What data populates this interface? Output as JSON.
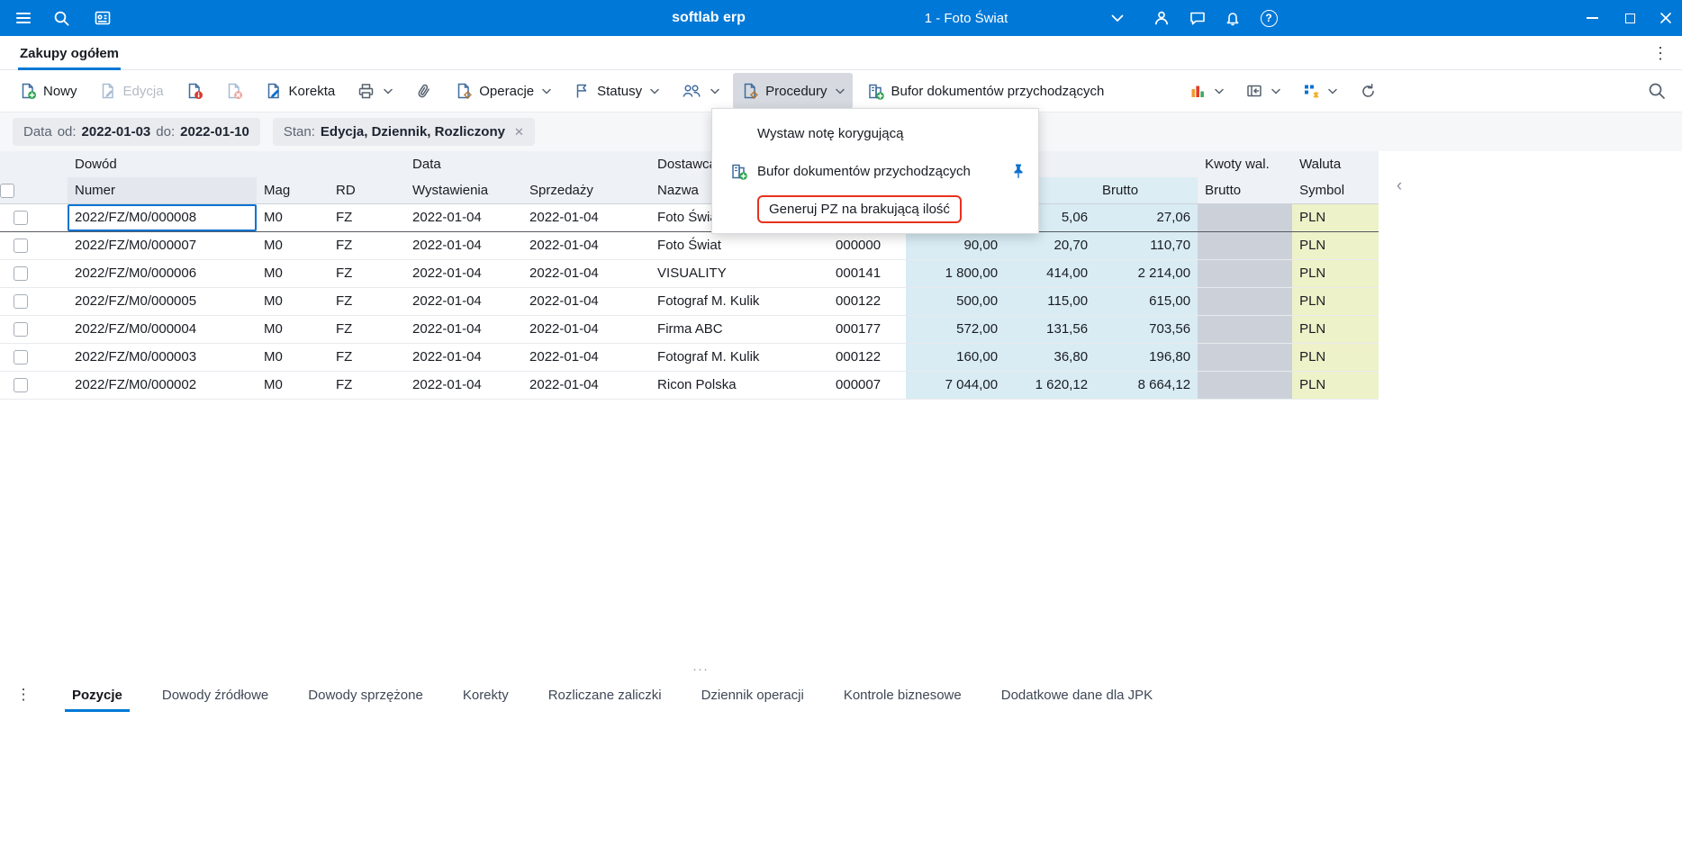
{
  "titlebar": {
    "title": "softlab erp",
    "company": "1 - Foto Świat"
  },
  "tabbar": {
    "active_tab": "Zakupy ogółem"
  },
  "toolbar": {
    "nowy": "Nowy",
    "edycja": "Edycja",
    "korekta": "Korekta",
    "operacje": "Operacje",
    "statusy": "Statusy",
    "procedury": "Procedury",
    "bufor": "Bufor dokumentów przychodzących"
  },
  "filterbar": {
    "data_label": "Data",
    "od_label": "od:",
    "od_value": "2022-01-03",
    "do_label": "do:",
    "do_value": "2022-01-10",
    "stan_label": "Stan:",
    "stan_value": "Edycja, Dziennik, Rozliczony"
  },
  "menu": {
    "item1": "Wystaw notę korygującą",
    "item2": "Bufor dokumentów przychodzących",
    "item3": "Generuj PZ na brakującą ilość"
  },
  "table": {
    "group_headers": {
      "dowod": "Dowód",
      "data": "Data",
      "dostawca": "Dostawca",
      "kwoty_wal": "Kwoty wal.",
      "waluta": "Waluta"
    },
    "column_headers": {
      "numer": "Numer",
      "mag": "Mag",
      "rd": "RD",
      "wystawienia": "Wystawienia",
      "sprzedazy": "Sprzedaży",
      "nazwa": "Nazwa",
      "brutto": "Brutto",
      "kwoty_brutto": "Brutto",
      "symbol": "Symbol"
    },
    "rows": [
      {
        "selected": true,
        "numer": "2022/FZ/M0/000008",
        "mag": "M0",
        "rd": "FZ",
        "wystawienia": "2022-01-04",
        "sprzedazy": "2022-01-04",
        "nazwa": "Foto Świat",
        "dostawca_numer": "",
        "netto": "",
        "vat": "5,06",
        "brutto": "27,06",
        "kwoty_brutto": "",
        "symbol": "PLN"
      },
      {
        "selected": false,
        "numer": "2022/FZ/M0/000007",
        "mag": "M0",
        "rd": "FZ",
        "wystawienia": "2022-01-04",
        "sprzedazy": "2022-01-04",
        "nazwa": "Foto Świat",
        "dostawca_numer": "000000",
        "netto": "90,00",
        "vat": "20,70",
        "brutto": "110,70",
        "kwoty_brutto": "",
        "symbol": "PLN"
      },
      {
        "selected": false,
        "numer": "2022/FZ/M0/000006",
        "mag": "M0",
        "rd": "FZ",
        "wystawienia": "2022-01-04",
        "sprzedazy": "2022-01-04",
        "nazwa": "VISUALITY",
        "dostawca_numer": "000141",
        "netto": "1 800,00",
        "vat": "414,00",
        "brutto": "2 214,00",
        "kwoty_brutto": "",
        "symbol": "PLN"
      },
      {
        "selected": false,
        "numer": "2022/FZ/M0/000005",
        "mag": "M0",
        "rd": "FZ",
        "wystawienia": "2022-01-04",
        "sprzedazy": "2022-01-04",
        "nazwa": "Fotograf M. Kulik",
        "dostawca_numer": "000122",
        "netto": "500,00",
        "vat": "115,00",
        "brutto": "615,00",
        "kwoty_brutto": "",
        "symbol": "PLN"
      },
      {
        "selected": false,
        "numer": "2022/FZ/M0/000004",
        "mag": "M0",
        "rd": "FZ",
        "wystawienia": "2022-01-04",
        "sprzedazy": "2022-01-04",
        "nazwa": "Firma ABC",
        "dostawca_numer": "000177",
        "netto": "572,00",
        "vat": "131,56",
        "brutto": "703,56",
        "kwoty_brutto": "",
        "symbol": "PLN"
      },
      {
        "selected": false,
        "numer": "2022/FZ/M0/000003",
        "mag": "M0",
        "rd": "FZ",
        "wystawienia": "2022-01-04",
        "sprzedazy": "2022-01-04",
        "nazwa": "Fotograf M. Kulik",
        "dostawca_numer": "000122",
        "netto": "160,00",
        "vat": "36,80",
        "brutto": "196,80",
        "kwoty_brutto": "",
        "symbol": "PLN"
      },
      {
        "selected": false,
        "numer": "2022/FZ/M0/000002",
        "mag": "M0",
        "rd": "FZ",
        "wystawienia": "2022-01-04",
        "sprzedazy": "2022-01-04",
        "nazwa": "Ricon Polska",
        "dostawca_numer": "000007",
        "netto": "7 044,00",
        "vat": "1 620,12",
        "brutto": "8 664,12",
        "kwoty_brutto": "",
        "symbol": "PLN"
      }
    ]
  },
  "bottom_tabs": {
    "items": [
      {
        "label": "Pozycje",
        "active": true
      },
      {
        "label": "Dowody źródłowe",
        "active": false
      },
      {
        "label": "Dowody sprzężone",
        "active": false
      },
      {
        "label": "Korekty",
        "active": false
      },
      {
        "label": "Rozliczane zaliczki",
        "active": false
      },
      {
        "label": "Dziennik operacji",
        "active": false
      },
      {
        "label": "Kontrole biznesowe",
        "active": false
      },
      {
        "label": "Dodatkowe dane dla JPK",
        "active": false
      }
    ]
  },
  "colors": {
    "titlebar_bg": "#0078d7",
    "accent_blue": "#0078d4",
    "numeric_cell_bg": "#d9ecf4",
    "currency_cell_bg": "#eef2c8",
    "amount_wal_cell_bg": "#ccd1d9",
    "highlight_red": "#e8321e",
    "focus_cell_border": "#0b72d0"
  },
  "icons": [
    "menu-icon",
    "search-icon",
    "contacts-icon",
    "chevron-down-icon",
    "user-icon",
    "chat-icon",
    "bell-icon",
    "help-icon",
    "minimize-icon",
    "maximize-icon",
    "close-icon",
    "new-document-icon",
    "edit-document-icon",
    "document-info-icon",
    "document-delete-icon",
    "correction-icon",
    "printer-icon",
    "paperclip-icon",
    "operations-icon",
    "status-flag-icon",
    "people-icon",
    "procedures-icon",
    "incoming-buffer-icon",
    "chart-icon",
    "panel-icon",
    "view-settings-icon",
    "refresh-icon",
    "table-search-icon",
    "pin-icon",
    "overflow-menu-icon",
    "drag-handle-icon",
    "collapse-columns-icon",
    "row-checkbox"
  ]
}
